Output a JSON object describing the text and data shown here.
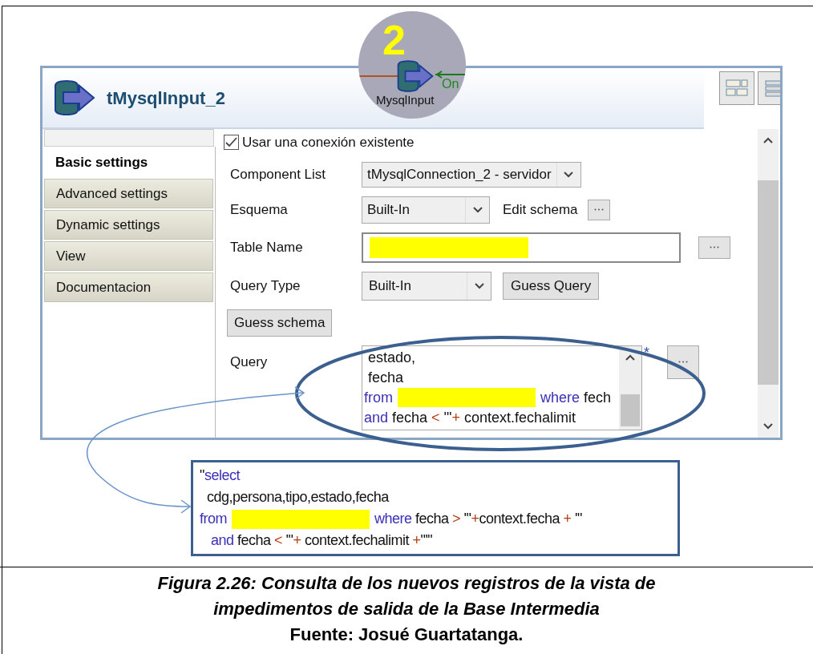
{
  "node_badge": {
    "number": "2",
    "label": "MysqlInput",
    "link_label": "On"
  },
  "component": {
    "title": "tMysqlInput_2"
  },
  "tabs": [
    {
      "label": "Basic settings",
      "selected": true
    },
    {
      "label": "Advanced settings",
      "selected": false
    },
    {
      "label": "Dynamic settings",
      "selected": false
    },
    {
      "label": "View",
      "selected": false
    },
    {
      "label": "Documentacion",
      "selected": false
    }
  ],
  "use_existing": {
    "label": "Usar una conexión existente",
    "checked": true
  },
  "component_list": {
    "label": "Component List",
    "value": "tMysqlConnection_2 - servidor"
  },
  "schema": {
    "label": "Esquema",
    "value": "Built-In",
    "edit_label": "Edit schema"
  },
  "table_name": {
    "label": "Table Name"
  },
  "query_type": {
    "label": "Query Type",
    "value": "Built-In",
    "button": "Guess Query"
  },
  "guess_schema_button": "Guess schema",
  "query": {
    "label": "Query",
    "modified_mark": "*",
    "lines": [
      [
        {
          "kind": "plain",
          "text": " estado,"
        }
      ],
      [
        {
          "kind": "plain",
          "text": " fecha"
        }
      ],
      [
        {
          "kind": "keyword",
          "text": "from"
        },
        {
          "kind": "redacted"
        },
        {
          "kind": "keyword",
          "text": "where"
        },
        {
          "kind": "plain",
          "text": " fech"
        }
      ],
      [
        {
          "kind": "keyword",
          "text": "and"
        },
        {
          "kind": "plain",
          "text": " fecha "
        },
        {
          "kind": "operator",
          "text": "<"
        },
        {
          "kind": "plain",
          "text": " '\""
        },
        {
          "kind": "operator",
          "text": "+"
        },
        {
          "kind": "plain",
          "text": " context.fechalimit"
        }
      ]
    ]
  },
  "code_callout": {
    "lines": [
      [
        {
          "kind": "plain",
          "text": "\""
        },
        {
          "kind": "keyword",
          "text": "select"
        }
      ],
      [
        {
          "kind": "plain",
          "text": "  cdg,persona,tipo,estado,fecha"
        }
      ],
      [
        {
          "kind": "keyword",
          "text": "from"
        },
        {
          "kind": "redacted"
        },
        {
          "kind": "keyword",
          "text": "where"
        },
        {
          "kind": "plain",
          "text": " fecha "
        },
        {
          "kind": "operator",
          "text": ">"
        },
        {
          "kind": "plain",
          "text": " '\""
        },
        {
          "kind": "operator",
          "text": "+"
        },
        {
          "kind": "plain",
          "text": "context.fecha "
        },
        {
          "kind": "operator",
          "text": "+"
        },
        {
          "kind": "plain",
          "text": " '\""
        }
      ],
      [
        {
          "kind": "indent"
        },
        {
          "kind": "keyword",
          "text": "and"
        },
        {
          "kind": "plain",
          "text": " fecha "
        },
        {
          "kind": "operator",
          "text": "<"
        },
        {
          "kind": "plain",
          "text": " '\""
        },
        {
          "kind": "operator",
          "text": "+"
        },
        {
          "kind": "plain",
          "text": " context.fechalimit "
        },
        {
          "kind": "operator",
          "text": "+"
        },
        {
          "kind": "plain",
          "text": "\"'\""
        }
      ]
    ]
  },
  "caption": {
    "lines": [
      "Figura 2.26: Consulta de los nuevos registros de la vista de",
      "impedimentos de salida de la Base Intermedia"
    ],
    "source": "Fuente: Josué Guartatanga."
  }
}
